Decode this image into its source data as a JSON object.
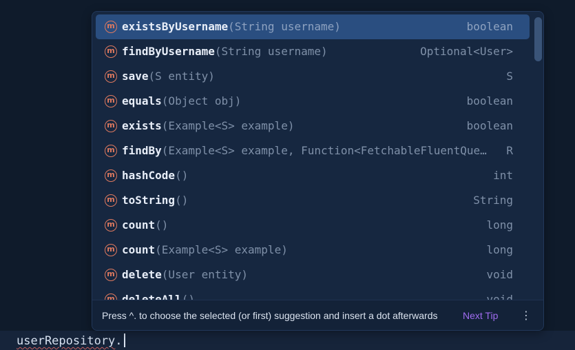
{
  "editor": {
    "identifier": "userRepository",
    "dot": "."
  },
  "completion": {
    "icon_letter": "m",
    "items": [
      {
        "name": "existsByUsername",
        "params": "(String username)",
        "return_type": "boolean",
        "selected": true
      },
      {
        "name": "findByUsername",
        "params": "(String username)",
        "return_type": "Optional<User>",
        "selected": false
      },
      {
        "name": "save",
        "params": "(S entity)",
        "return_type": "S",
        "selected": false
      },
      {
        "name": "equals",
        "params": "(Object obj)",
        "return_type": "boolean",
        "selected": false
      },
      {
        "name": "exists",
        "params": "(Example<S> example)",
        "return_type": "boolean",
        "selected": false
      },
      {
        "name": "findBy",
        "params": "(Example<S> example, Function<FetchableFluentQue…",
        "return_type": "R",
        "selected": false
      },
      {
        "name": "hashCode",
        "params": "()",
        "return_type": "int",
        "selected": false
      },
      {
        "name": "toString",
        "params": "()",
        "return_type": "String",
        "selected": false
      },
      {
        "name": "count",
        "params": "()",
        "return_type": "long",
        "selected": false
      },
      {
        "name": "count",
        "params": "(Example<S> example)",
        "return_type": "long",
        "selected": false
      },
      {
        "name": "delete",
        "params": "(User entity)",
        "return_type": "void",
        "selected": false
      },
      {
        "name": "deleteAll",
        "params": "()",
        "return_type": "void",
        "selected": false
      }
    ],
    "footer": {
      "hint": "Press ^. to choose the selected (or first) suggestion and insert a dot afterwards",
      "next_tip": "Next Tip",
      "more_icon": "more-vertical-icon"
    }
  },
  "colors": {
    "editor_bg": "#0f1b2b",
    "popup_bg": "#162740",
    "selection": "#2a4e80",
    "method_icon": "#e07a5f",
    "link": "#a06cf0"
  }
}
